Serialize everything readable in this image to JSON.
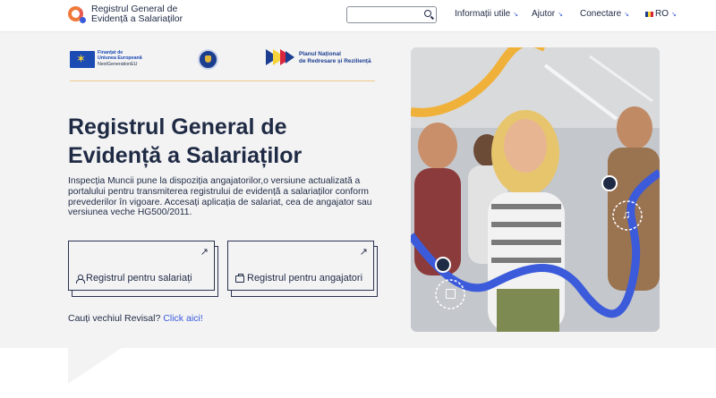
{
  "header": {
    "logo_line1": "Registrul General de",
    "logo_line2": "Evidență a Salariaților",
    "search_placeholder": "",
    "nav": [
      {
        "label": "Informații utile",
        "arrow": "↘"
      },
      {
        "label": "Ajutor",
        "arrow": "↘"
      },
      {
        "label": "Conectare",
        "arrow": "↘"
      },
      {
        "label": "RO",
        "arrow": "↘"
      }
    ]
  },
  "partners": {
    "eu_line1": "Finanțat de",
    "eu_line2": "Uniunea Europeană",
    "eu_line3": "NextGenerationEU",
    "pnrr_line1": "Planul Național",
    "pnrr_line2": "de Redresare și Reziliență"
  },
  "hero": {
    "title_line1": "Registrul General de",
    "title_line2": "Evidență a Salariaților",
    "lead": "Inspecția Muncii pune la dispoziția angajatorilor,o versiune actualizată a portalului pentru transmiterea registrului de evidență a salariaților conform prevederilor în vigoare. Accesați aplicația de salariat, cea de angajator sau versiunea veche HG500/2011.",
    "card_employees": "Registrul pentru salariați",
    "card_employers": "Registrul pentru angajatori",
    "card_arrow": "↗",
    "revisal_question": "Cauți vechiul Revisal?",
    "revisal_link": "Click aici!"
  },
  "colors": {
    "accent": "#3b5bdb",
    "brand_orange": "#f07a3a",
    "navy": "#1f2a44",
    "hero_bg": "#f3f3f4"
  },
  "icons": [
    "search-icon",
    "user-icon",
    "briefcase-icon",
    "external-arrow-icon",
    "music-note-icon",
    "book-icon"
  ]
}
